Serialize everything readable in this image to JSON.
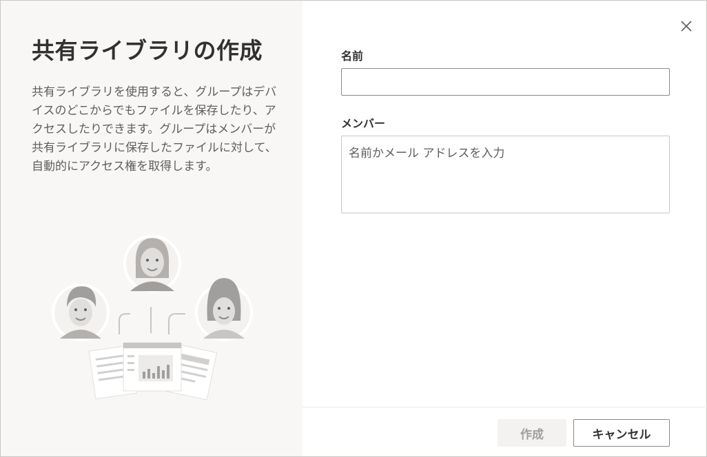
{
  "left_panel": {
    "title": "共有ライブラリの作成",
    "description": "共有ライブラリを使用すると、グループはデバイスのどこからでもファイルを保存したり、アクセスしたりできます。グループはメンバーが共有ライブラリに保存したファイルに対して、自動的にアクセス権を取得します。",
    "illustration_icon": "people-sharing-files-illustration"
  },
  "form": {
    "name_label": "名前",
    "name_value": "",
    "members_label": "メンバー",
    "members_placeholder": "名前かメール アドレスを入力"
  },
  "footer": {
    "create_label": "作成",
    "cancel_label": "キャンセル"
  },
  "icons": {
    "close": "close-icon"
  },
  "colors": {
    "left_panel_bg": "#f8f7f6",
    "text_primary": "#323130",
    "text_secondary": "#605e5c",
    "disabled_button_bg": "#f3f2f1",
    "disabled_button_text": "#a19f9d"
  }
}
